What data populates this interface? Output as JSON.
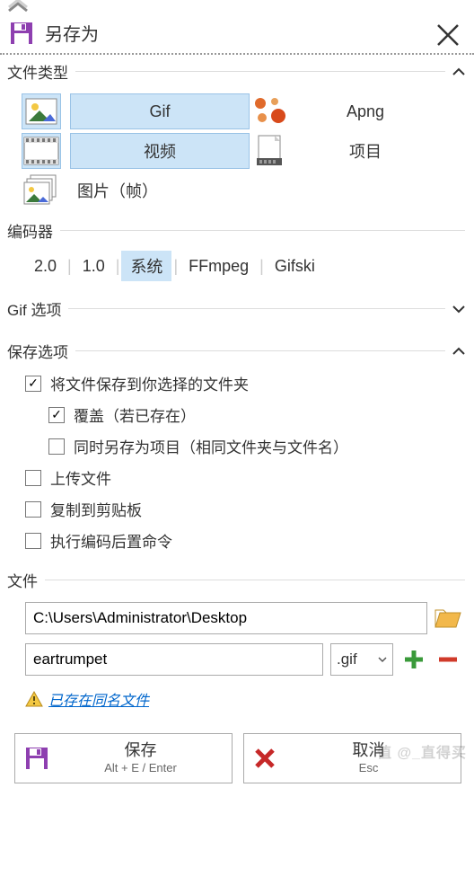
{
  "ui": {
    "chevron_top": "︽"
  },
  "title": "另存为",
  "sections": {
    "filetype": {
      "label": "文件类型"
    },
    "encoder": {
      "label": "编码器"
    },
    "gif_options": {
      "label": "Gif 选项"
    },
    "save_options": {
      "label": "保存选项"
    },
    "file": {
      "label": "文件"
    }
  },
  "filetypes": {
    "gif": "Gif",
    "apng": "Apng",
    "video": "视频",
    "project": "项目",
    "image_frames": "图片（帧）"
  },
  "encoders": {
    "e20": "2.0",
    "e10": "1.0",
    "system": "系统",
    "ffmpeg": "FFmpeg",
    "gifski": "Gifski"
  },
  "save_opts": {
    "save_to_folder": "将文件保存到你选择的文件夹",
    "overwrite": "覆盖（若已存在）",
    "also_save_project": "同时另存为项目（相同文件夹与文件名）",
    "upload": "上传文件",
    "copy_clipboard": "复制到剪贴板",
    "post_encode_cmd": "执行编码后置命令"
  },
  "file": {
    "path": "C:\\Users\\Administrator\\Desktop",
    "name": "eartrumpet",
    "ext": ".gif",
    "warn": "已存在同名文件"
  },
  "buttons": {
    "save": "保存",
    "save_shortcut": "Alt + E / Enter",
    "cancel": "取消",
    "cancel_shortcut": "Esc"
  },
  "watermark": "值 @_直得买"
}
